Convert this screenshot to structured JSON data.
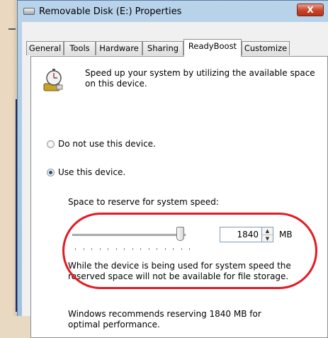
{
  "window": {
    "title": "Removable Disk (E:) Properties",
    "close_glyph": "X"
  },
  "tabs": [
    {
      "label": "General"
    },
    {
      "label": "Tools"
    },
    {
      "label": "Hardware"
    },
    {
      "label": "Sharing"
    },
    {
      "label": "ReadyBoost"
    },
    {
      "label": "Customize"
    }
  ],
  "active_tab": "ReadyBoost",
  "readyboost": {
    "description": "Speed up your system by utilizing the available space on this device.",
    "option_do_not_use": "Do not use this device.",
    "option_use": "Use this device.",
    "selected_option": "use",
    "reserve_label": "Space to reserve for system speed:",
    "reserve_value": "1840",
    "reserve_unit": "MB",
    "reserve_warning": "While the device is being used for system speed the reserved space will not be available for file storage.",
    "recommendation": "Windows recommends reserving 1840 MB for optimal performance.",
    "slider_level_fraction": 0.92
  },
  "colors": {
    "highlight_ring": "#e21b24",
    "titlebar": "#b9d3ea"
  },
  "icons": {
    "title": "removable-disk-icon",
    "feature": "readyboost-stopwatch-icon"
  }
}
